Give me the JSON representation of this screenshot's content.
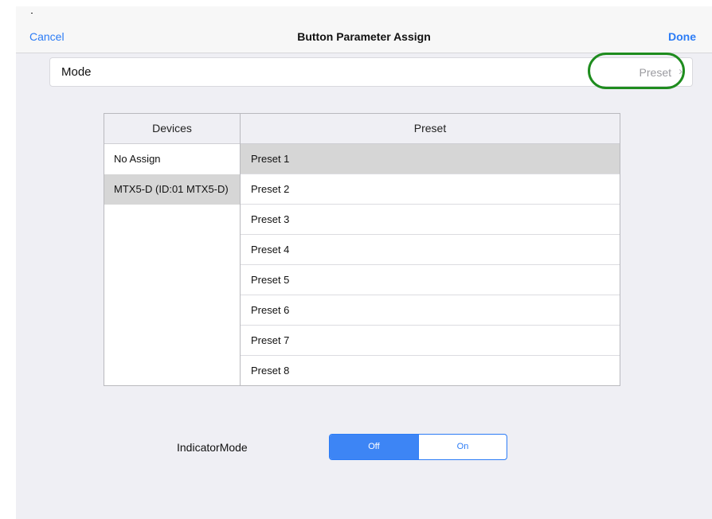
{
  "nav": {
    "cancel": "Cancel",
    "title": "Button Parameter Assign",
    "done": "Done"
  },
  "mode": {
    "label": "Mode",
    "value": "Preset",
    "chevron": "›"
  },
  "table": {
    "devices_header": "Devices",
    "preset_header": "Preset",
    "devices": [
      {
        "label": "No Assign",
        "selected": false
      },
      {
        "label": "MTX5-D (ID:01 MTX5-D)",
        "selected": true
      }
    ],
    "presets": [
      {
        "label": "Preset 1",
        "selected": true
      },
      {
        "label": "Preset 2",
        "selected": false
      },
      {
        "label": "Preset 3",
        "selected": false
      },
      {
        "label": "Preset 4",
        "selected": false
      },
      {
        "label": "Preset 5",
        "selected": false
      },
      {
        "label": "Preset 6",
        "selected": false
      },
      {
        "label": "Preset 7",
        "selected": false
      },
      {
        "label": "Preset 8",
        "selected": false
      }
    ]
  },
  "indicator": {
    "label": "IndicatorMode",
    "options": [
      "Off",
      "On"
    ],
    "selected": "Off"
  },
  "colors": {
    "accent": "#2c7cf6",
    "highlight_ring": "#1e8c1e",
    "selected_row": "#d6d6d6",
    "background": "#efeff4"
  }
}
